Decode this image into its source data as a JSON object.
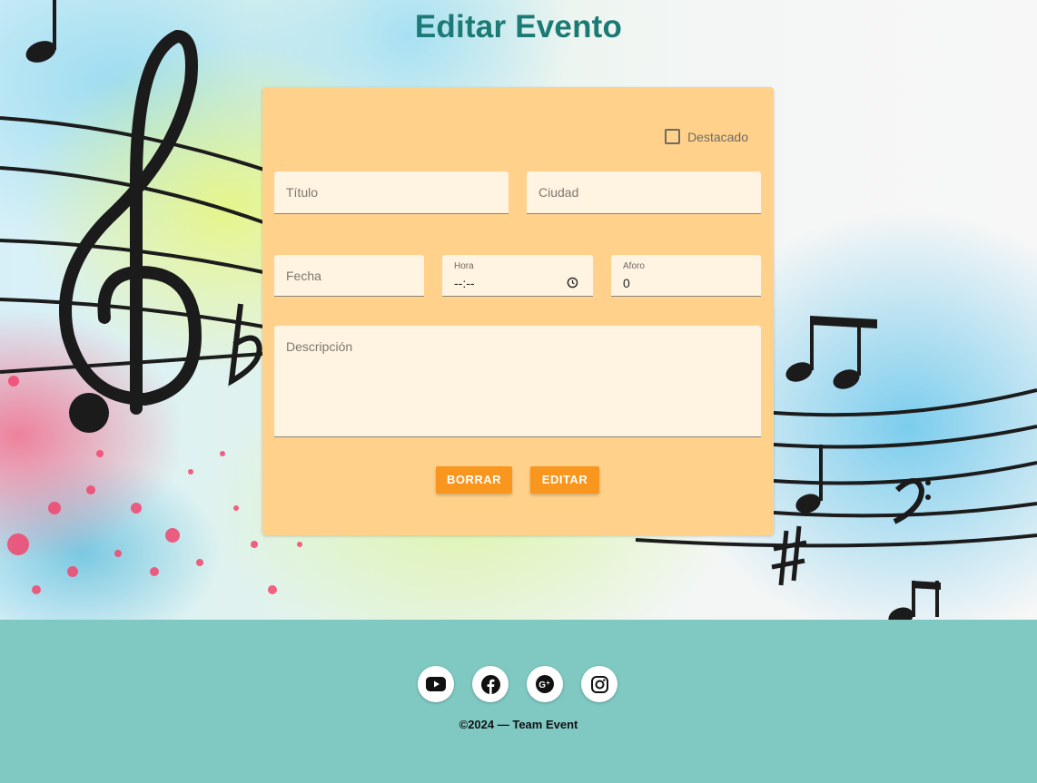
{
  "page": {
    "title": "Editar Evento"
  },
  "form": {
    "featured_label": "Destacado",
    "featured_checked": false,
    "title_placeholder": "Título",
    "city_placeholder": "Ciudad",
    "date_placeholder": "Fecha",
    "time_label": "Hora",
    "time_value": "--:--",
    "capacity_label": "Aforo",
    "capacity_value": "0",
    "description_placeholder": "Descripción",
    "delete_label": "BORRAR",
    "edit_label": "EDITAR"
  },
  "footer": {
    "social": [
      "youtube-icon",
      "facebook-icon",
      "google-plus-icon",
      "instagram-icon"
    ],
    "copyright": "©2024 — Team Event"
  },
  "colors": {
    "title": "#1b7a73",
    "card": "#ffd18b",
    "field": "#fff3e2",
    "button": "#f8961e",
    "footer": "#80c9c3"
  }
}
